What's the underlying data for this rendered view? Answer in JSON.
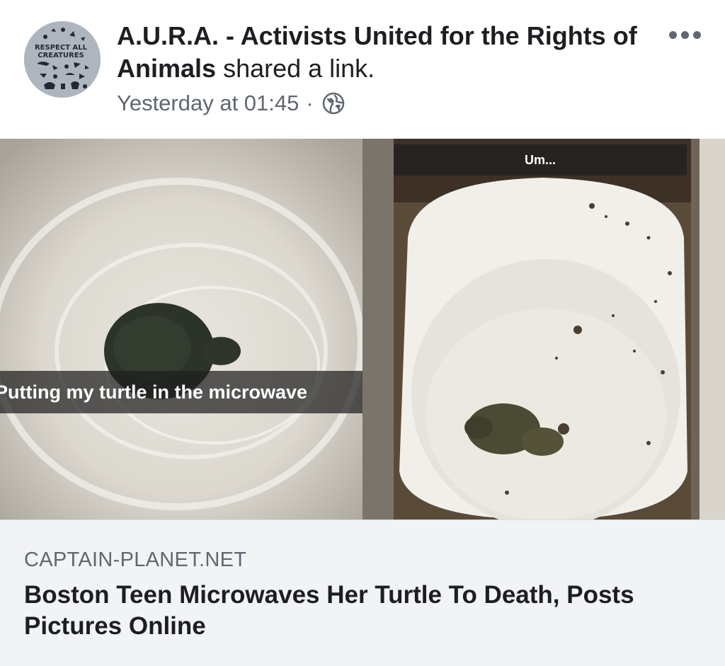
{
  "post": {
    "author": "A.U.R.A. - Activists United for the Rights of Animals",
    "action": "shared a link.",
    "timestamp": "Yesterday at 01:45",
    "separator": "·",
    "privacy_icon": "globe-icon",
    "avatar_text_line1": "RESPECT ALL",
    "avatar_text_line2": "CREATURES"
  },
  "images": {
    "left_caption": "Putting my turtle in the microwave",
    "right_caption": "Um..."
  },
  "link_preview": {
    "domain": "CAPTAIN-PLANET.NET",
    "title": "Boston Teen Microwaves Her Turtle To Death, Posts Pictures Online"
  },
  "colors": {
    "author_text": "#1c1e21",
    "meta_text": "#606770",
    "link_bg": "#f2f3f5"
  }
}
